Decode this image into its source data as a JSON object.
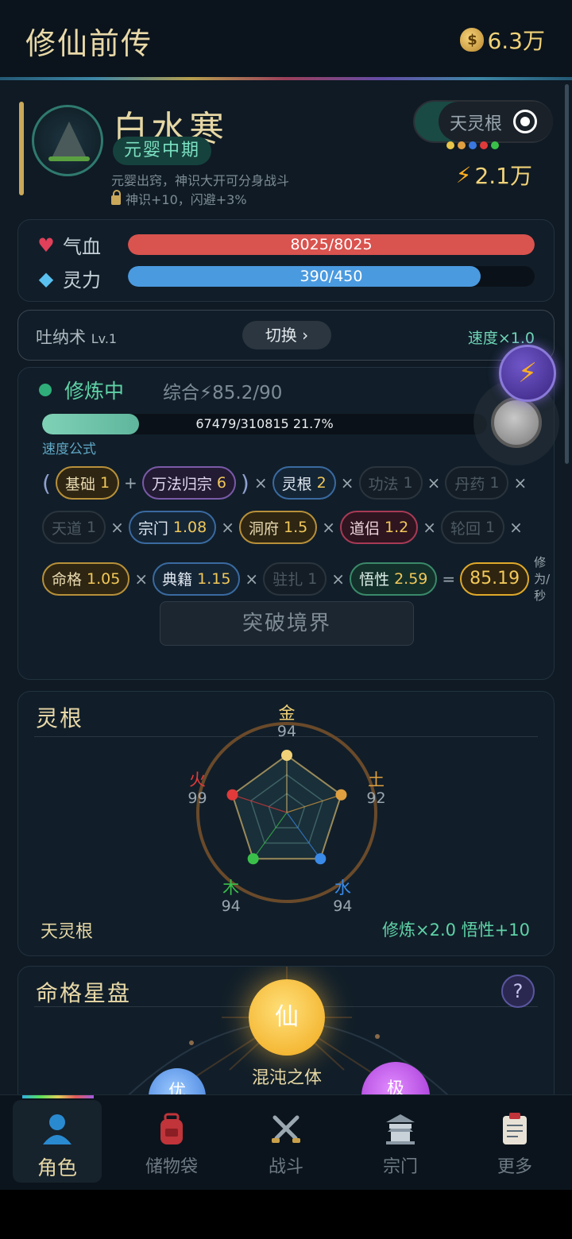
{
  "app": {
    "title": "修仙前传",
    "gold": "6.3万"
  },
  "profile": {
    "name": "白水寒",
    "realm": "元婴中期",
    "realm_desc": "元婴出窍，神识大开可分身战斗",
    "realm_bonus": "神识+10，闪避+3%",
    "root_label": "天灵根",
    "root_dot_colors": [
      "#e8c64a",
      "#e0a040",
      "#3a78e0",
      "#e03a3a",
      "#3ac04a"
    ],
    "power": "2.1万"
  },
  "stats": {
    "hp": {
      "label": "气血",
      "value": "8025/8025",
      "fraction": 1.0,
      "color": "#d9534f"
    },
    "mp": {
      "label": "灵力",
      "value": "390/450",
      "fraction": 0.867,
      "color": "#4a9ae0"
    }
  },
  "technique": {
    "name": "吐纳术",
    "level": "Lv.1",
    "switch_label": "切换 ›",
    "speed": "速度×1.0"
  },
  "cultivation": {
    "status": "修炼中",
    "score": "综合⚡85.2/90",
    "progress_text": "67479/310815  21.7%",
    "progress_fraction": 0.217,
    "formula_label": "速度公式",
    "row1": [
      {
        "t": "paren",
        "s": "("
      },
      {
        "t": "pill",
        "c": "p-gold",
        "n": "基础",
        "v": "1"
      },
      {
        "t": "op",
        "s": "+"
      },
      {
        "t": "pill",
        "c": "p-purple",
        "n": "万法归宗",
        "v": "6"
      },
      {
        "t": "paren",
        "s": ")"
      },
      {
        "t": "op",
        "s": "×"
      },
      {
        "t": "pill",
        "c": "p-blue",
        "n": "灵根",
        "v": "2"
      },
      {
        "t": "op",
        "s": "×"
      },
      {
        "t": "pill",
        "c": "p-dim",
        "n": "功法",
        "v": "1"
      },
      {
        "t": "op",
        "s": "×"
      },
      {
        "t": "pill",
        "c": "p-dim",
        "n": "丹药",
        "v": "1"
      },
      {
        "t": "op",
        "s": "×"
      }
    ],
    "row2": [
      {
        "t": "pill",
        "c": "p-dim",
        "n": "天道",
        "v": "1"
      },
      {
        "t": "op",
        "s": "×"
      },
      {
        "t": "pill",
        "c": "p-blue",
        "n": "宗门",
        "v": "1.08"
      },
      {
        "t": "op",
        "s": "×"
      },
      {
        "t": "pill",
        "c": "p-gold",
        "n": "洞府",
        "v": "1.5"
      },
      {
        "t": "op",
        "s": "×"
      },
      {
        "t": "pill",
        "c": "p-red",
        "n": "道侣",
        "v": "1.2"
      },
      {
        "t": "op",
        "s": "×"
      },
      {
        "t": "pill",
        "c": "p-dim",
        "n": "轮回",
        "v": "1"
      },
      {
        "t": "op",
        "s": "×"
      }
    ],
    "row3": [
      {
        "t": "pill",
        "c": "p-gold",
        "n": "命格",
        "v": "1.05"
      },
      {
        "t": "op",
        "s": "×"
      },
      {
        "t": "pill",
        "c": "p-blue",
        "n": "典籍",
        "v": "1.15"
      },
      {
        "t": "op",
        "s": "×"
      },
      {
        "t": "pill",
        "c": "p-dim",
        "n": "驻扎",
        "v": "1"
      },
      {
        "t": "op",
        "s": "×"
      },
      {
        "t": "pill",
        "c": "p-teal",
        "n": "悟性",
        "v": "2.59"
      },
      {
        "t": "op",
        "s": "="
      },
      {
        "t": "pill",
        "c": "p-result",
        "n": "",
        "v": "85.19"
      },
      {
        "t": "unit",
        "s": "修为/秒"
      }
    ],
    "breakthrough_label": "突破境界"
  },
  "spirit_root": {
    "title": "灵根",
    "name": "天灵根",
    "bonus": "修炼×2.0  悟性+10",
    "elements": [
      {
        "name": "金",
        "value": "94",
        "color": "#f1d278"
      },
      {
        "name": "土",
        "value": "92",
        "color": "#e0a040"
      },
      {
        "name": "水",
        "value": "94",
        "color": "#3a8ae8"
      },
      {
        "name": "木",
        "value": "94",
        "color": "#3ac04a"
      },
      {
        "name": "火",
        "value": "99",
        "color": "#e03a3a"
      }
    ]
  },
  "destiny": {
    "title": "命格星盘",
    "help": "?",
    "center": "仙",
    "center_label": "混沌之体",
    "left_star": "优",
    "right_star": "极"
  },
  "nav": [
    {
      "label": "角色",
      "icon": "person-icon",
      "active": true
    },
    {
      "label": "储物袋",
      "icon": "backpack-icon",
      "active": false
    },
    {
      "label": "战斗",
      "icon": "swords-icon",
      "active": false
    },
    {
      "label": "宗门",
      "icon": "temple-icon",
      "active": false
    },
    {
      "label": "更多",
      "icon": "clipboard-icon",
      "active": false
    }
  ]
}
